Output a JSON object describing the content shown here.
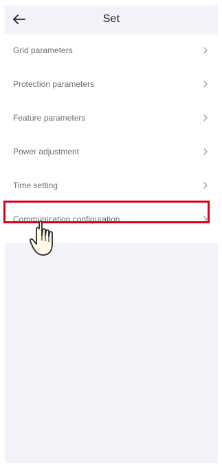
{
  "header": {
    "title": "Set",
    "back_icon": "arrow-left-icon"
  },
  "menu": {
    "items": [
      {
        "label": "Grid parameters",
        "icon": "chevron-right-icon"
      },
      {
        "label": "Protection parameters",
        "icon": "chevron-right-icon"
      },
      {
        "label": "Feature parameters",
        "icon": "chevron-right-icon"
      },
      {
        "label": "Power adjustment",
        "icon": "chevron-right-icon"
      },
      {
        "label": "Time setting",
        "icon": "chevron-right-icon"
      },
      {
        "label": "Communication configuration",
        "icon": "chevron-right-icon"
      }
    ],
    "selected_item": "Communication configuration"
  },
  "annotation": {
    "highlight_color": "#d6001c",
    "pointer_icon": "hand-pointer-icon"
  },
  "colors": {
    "background": "#f1f3f8",
    "card": "#ffffff",
    "text": "#6d6d6d",
    "title": "#222222"
  }
}
